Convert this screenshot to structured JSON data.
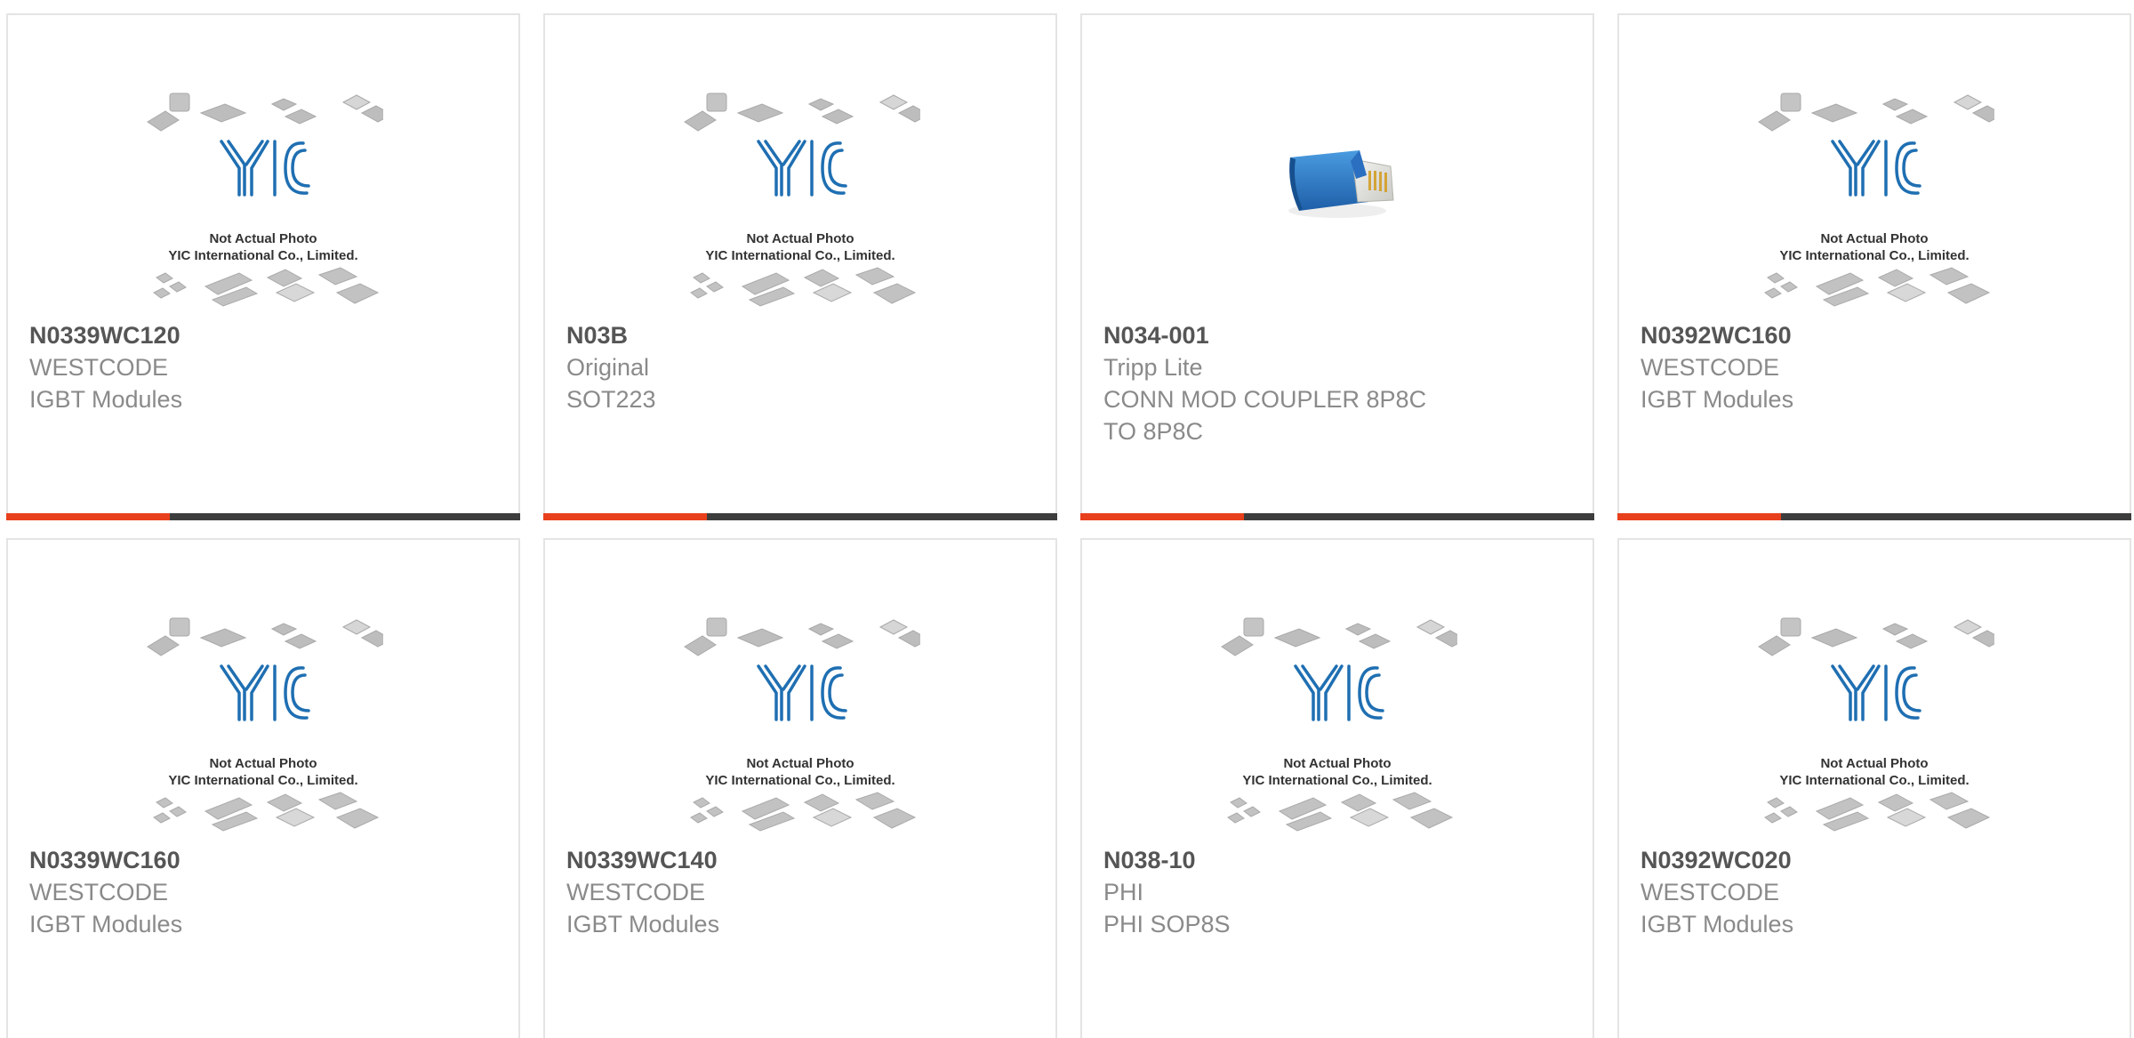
{
  "products": [
    {
      "part": "N0339WC120",
      "maker": "WESTCODE",
      "desc": "IGBT Modules",
      "desc2": "",
      "image": "placeholder",
      "caption1": "Not Actual Photo",
      "caption2": "YIC International Co., Limited."
    },
    {
      "part": "N03B",
      "maker": "Original",
      "desc": "SOT223",
      "desc2": "",
      "image": "placeholder",
      "caption1": "Not Actual Photo",
      "caption2": "YIC International Co., Limited."
    },
    {
      "part": "N034-001",
      "maker": "Tripp Lite",
      "desc": "CONN MOD COUPLER 8P8C",
      "desc2": "TO 8P8C",
      "image": "coupler-photo",
      "caption1": "",
      "caption2": ""
    },
    {
      "part": "N0392WC160",
      "maker": "WESTCODE",
      "desc": "IGBT Modules",
      "desc2": "",
      "image": "placeholder",
      "caption1": "Not Actual Photo",
      "caption2": "YIC International Co., Limited."
    },
    {
      "part": "N0339WC160",
      "maker": "WESTCODE",
      "desc": "IGBT Modules",
      "desc2": "",
      "image": "placeholder",
      "caption1": "Not Actual Photo",
      "caption2": "YIC International Co., Limited."
    },
    {
      "part": "N0339WC140",
      "maker": "WESTCODE",
      "desc": "IGBT Modules",
      "desc2": "",
      "image": "placeholder",
      "caption1": "Not Actual Photo",
      "caption2": "YIC International Co., Limited."
    },
    {
      "part": "N038-10",
      "maker": "PHI",
      "desc": "PHI SOP8S",
      "desc2": "",
      "image": "placeholder",
      "caption1": "Not Actual Photo",
      "caption2": "YIC International Co., Limited."
    },
    {
      "part": "N0392WC020",
      "maker": "WESTCODE",
      "desc": "IGBT Modules",
      "desc2": "",
      "image": "placeholder",
      "caption1": "Not Actual Photo",
      "caption2": "YIC International Co., Limited."
    }
  ],
  "colors": {
    "accent": "#e8401c",
    "bar": "#3d3d3d",
    "logo": "#1f6fb2",
    "part": "#555555",
    "text": "#8a8a8a"
  }
}
